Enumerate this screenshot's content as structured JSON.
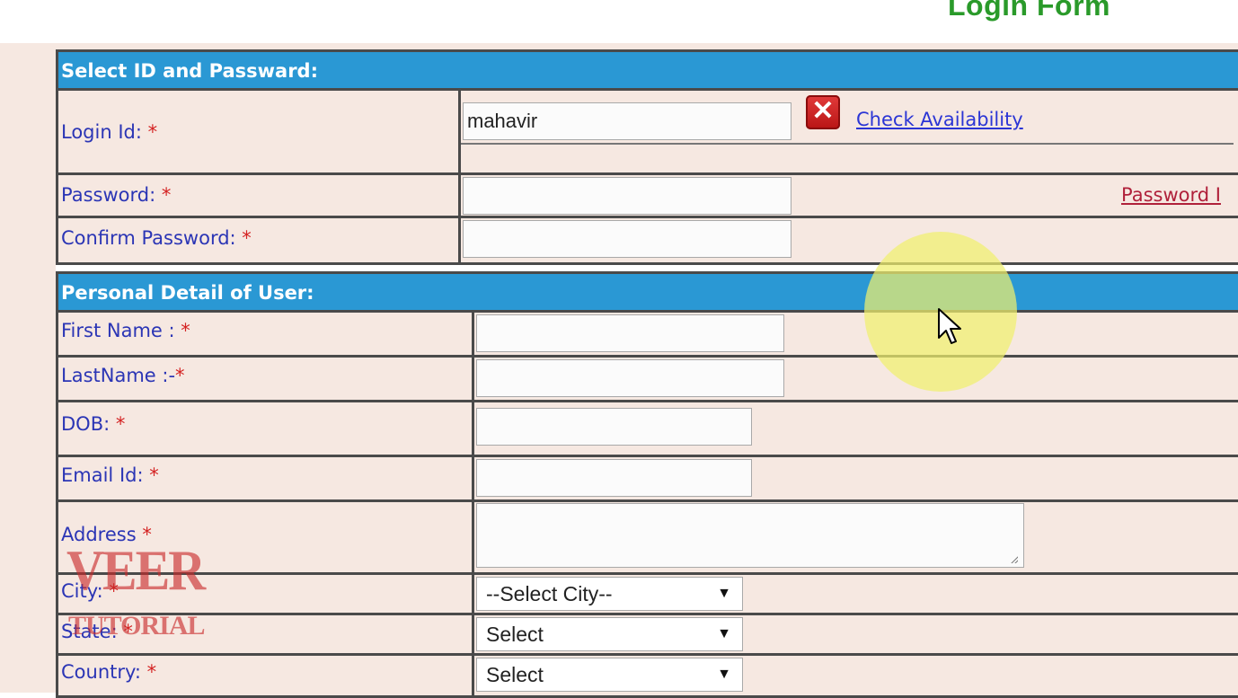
{
  "page": {
    "title": "Login Form"
  },
  "section_login": {
    "header": "Select ID and Passward:",
    "login_id": {
      "label": "Login Id: ",
      "req": "*",
      "value": "mahavir",
      "check_link": "Check Availability"
    },
    "password": {
      "label": "Password: ",
      "req": "*",
      "value": "",
      "strength_link": "Password I"
    },
    "confirm": {
      "label": "Confirm Password: ",
      "req": "*",
      "value": ""
    }
  },
  "section_personal": {
    "header": "Personal Detail of User:",
    "first_name": {
      "label": "First Name : ",
      "req": "*",
      "value": ""
    },
    "last_name": {
      "label": "LastName :-",
      "req": "*",
      "value": ""
    },
    "dob": {
      "label": "DOB: ",
      "req": "*",
      "value": ""
    },
    "email": {
      "label": "Email Id: ",
      "req": "*",
      "value": ""
    },
    "address": {
      "label": "Address ",
      "req": "*",
      "value": ""
    },
    "city": {
      "label": "City: ",
      "req": "*",
      "selected": "--Select City--"
    },
    "state": {
      "label": "State: ",
      "req": "*",
      "selected": "Select"
    },
    "country": {
      "label": "Country: ",
      "req": "*",
      "selected": "Select"
    }
  },
  "watermark": {
    "line1": "VEER",
    "line2": "TUTORIAL"
  },
  "icons": {
    "remove": "x-icon",
    "dropdown": "triangle-down-icon",
    "pointer": "cursor-arrow-icon"
  },
  "colors": {
    "header_bg": "#2a98d4",
    "form_bg": "#f6e8e1",
    "label": "#2b35b5",
    "required": "#d42222",
    "title": "#2a9a2a"
  }
}
